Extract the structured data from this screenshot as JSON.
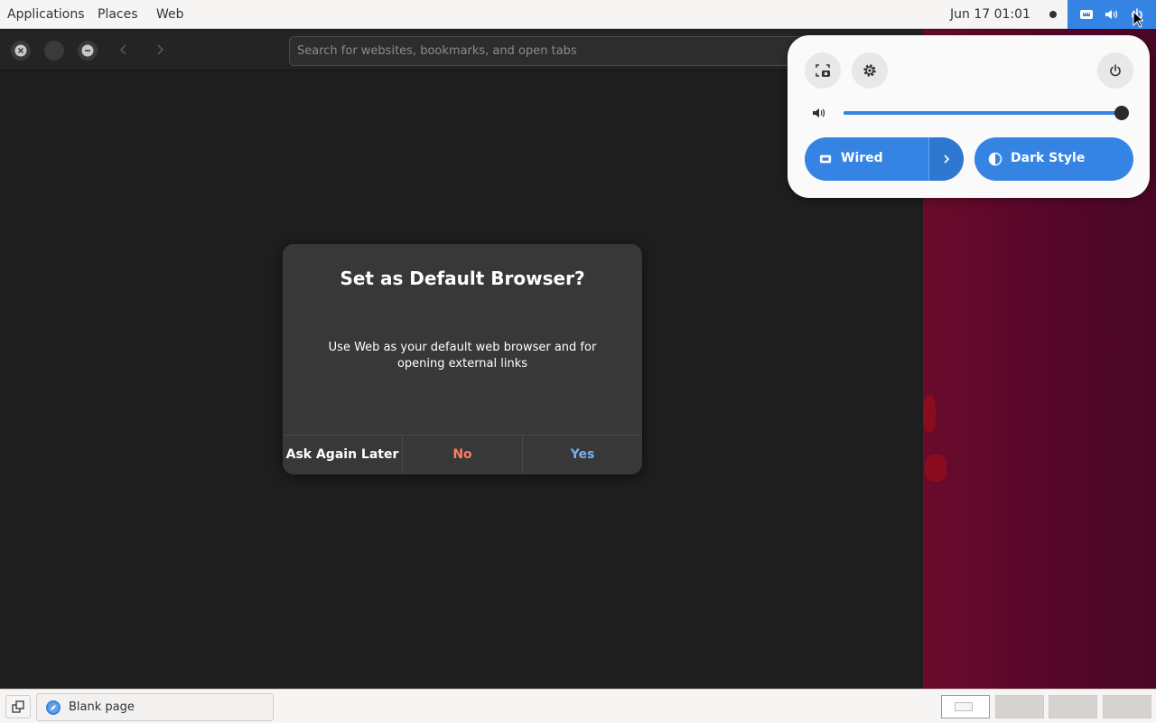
{
  "topbar": {
    "menu": [
      "Applications",
      "Places",
      "Web"
    ],
    "clock": "Jun 17  01:01",
    "status_icons": [
      "network-wired-icon",
      "volume-icon",
      "power-icon"
    ]
  },
  "browser": {
    "window_buttons": [
      "close-icon",
      "maximize-icon",
      "minimize-icon"
    ],
    "nav_buttons": [
      "back-arrow-icon",
      "forward-arrow-icon"
    ],
    "address_placeholder": "Search for websites, bookmarks, and open tabs"
  },
  "dialog": {
    "title": "Set as Default Browser?",
    "body": "Use Web as your default web browser and for opening external links",
    "buttons": {
      "later": "Ask Again Later",
      "no": "No",
      "yes": "Yes"
    }
  },
  "quick_settings": {
    "buttons": [
      "screenshot-icon",
      "settings-gear-icon",
      "power-icon"
    ],
    "volume_level": 1.0,
    "toggles": {
      "wired": "Wired",
      "dark_style": "Dark Style"
    }
  },
  "taskbar": {
    "task_label": "Blank page",
    "workspaces": 4,
    "active_workspace": 1
  },
  "colors": {
    "accent": "#3584e4",
    "destructive": "#ff7b63",
    "suggested": "#78aeed",
    "dialog_bg": "#383838"
  }
}
